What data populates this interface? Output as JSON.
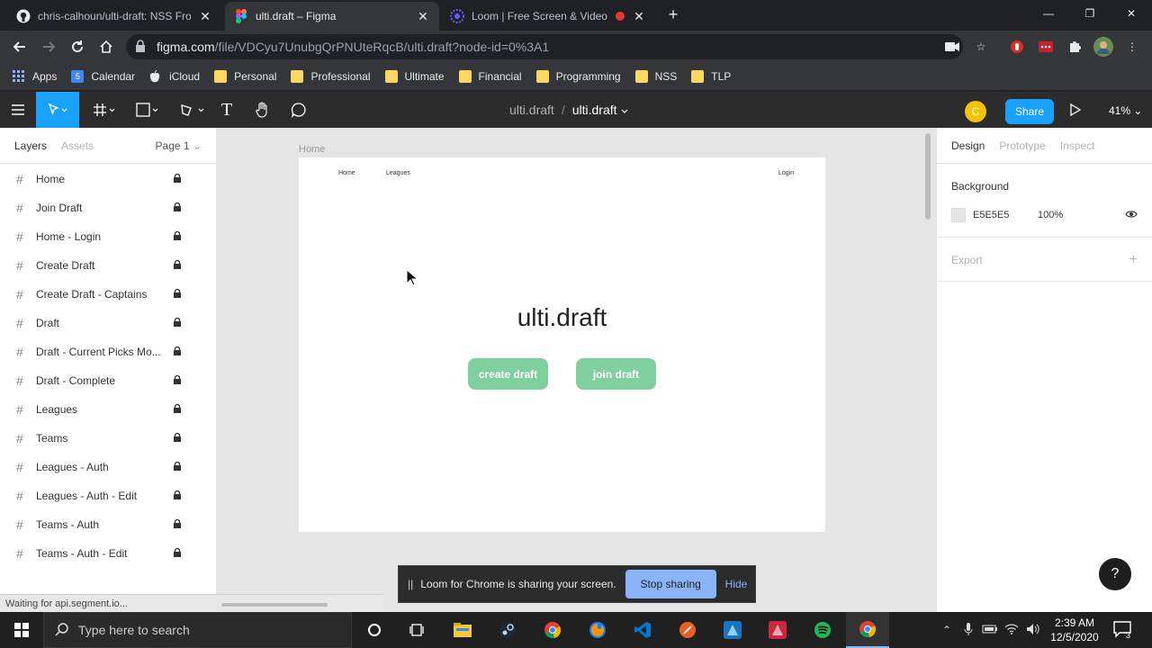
{
  "browser": {
    "tabs": [
      {
        "title": "chris-calhoun/ulti-draft: NSS Fron",
        "active": false
      },
      {
        "title": "ulti.draft – Figma",
        "active": true
      },
      {
        "title": "Loom | Free Screen & Video",
        "active": false
      }
    ],
    "url_host": "figma.com",
    "url_path": "/file/VDCyu7UnubgQrPNUteRqcB/ulti.draft?node-id=0%3A1",
    "bookmarks": [
      "Apps",
      "Calendar",
      "iCloud",
      "Personal",
      "Professional",
      "Ultimate",
      "Financial",
      "Programming",
      "NSS",
      "TLP"
    ],
    "calendar_day": "5"
  },
  "figma": {
    "breadcrumb_project": "ulti.draft",
    "breadcrumb_sep": "/",
    "file_name": "ulti.draft",
    "avatar_letter": "C",
    "share_label": "Share",
    "zoom": "41%",
    "left_tabs": [
      "Layers",
      "Assets"
    ],
    "page_selector": "Page 1",
    "layers": [
      "Home",
      "Join Draft",
      "Home - Login",
      "Create Draft",
      "Create Draft - Captains",
      "Draft",
      "Draft - Current Picks Mo...",
      "Draft - Complete",
      "Leagues",
      "Teams",
      "Leagues - Auth",
      "Leagues - Auth - Edit",
      "Teams - Auth",
      "Teams - Auth - Edit"
    ],
    "right_tabs": [
      "Design",
      "Prototype",
      "Inspect"
    ],
    "background_heading": "Background",
    "background_hex": "E5E5E5",
    "background_opacity": "100%",
    "export_heading": "Export",
    "help_label": "?"
  },
  "frame": {
    "label": "Home",
    "nav_home": "Home",
    "nav_leagues": "Leagues",
    "nav_login": "Login",
    "title": "ulti.draft",
    "create_button": "create draft",
    "join_button": "join draft"
  },
  "loom": {
    "message": "Loom for Chrome is sharing your screen.",
    "stop_label": "Stop sharing",
    "hide_label": "Hide"
  },
  "status_bubble": "Waiting for api.segment.io...",
  "taskbar": {
    "search_placeholder": "Type here to search",
    "time": "2:39 AM",
    "date": "12/5/2020",
    "notification_count": "3"
  },
  "colors": {
    "figma_blue": "#18a0fb",
    "button_green": "#7fcf9f",
    "canvas_bg": "#e5e5e5"
  }
}
